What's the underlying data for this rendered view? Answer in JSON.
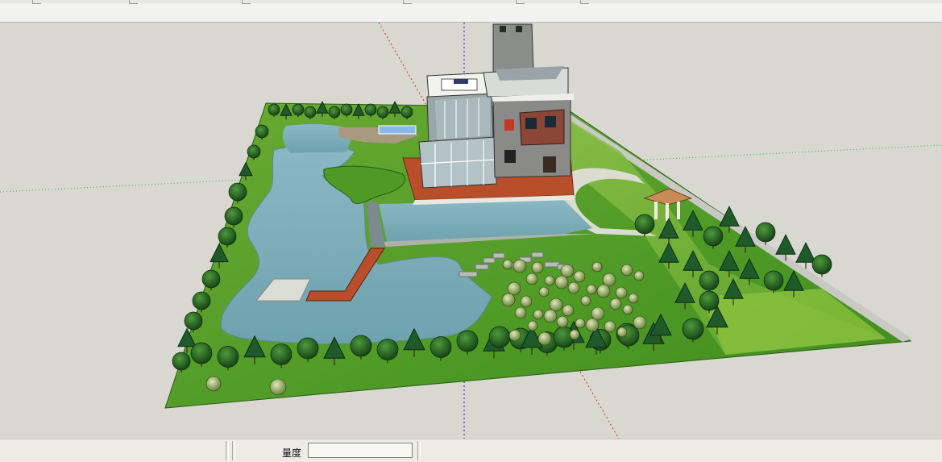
{
  "status_bar": {
    "measurement_label": "量度",
    "measurement_value": ""
  },
  "icons": {
    "toolbar": [
      "toolbar-icon"
    ],
    "model": [
      "axis-icon"
    ]
  },
  "colors": {
    "sky": "#d8d8d0",
    "lawn": "#4f9a26",
    "water": "#7fb0bc",
    "deck": "#b84e2a",
    "axis_red": "#c8322a",
    "axis_green": "#2bb24a",
    "axis_blue": "#2222cc"
  }
}
